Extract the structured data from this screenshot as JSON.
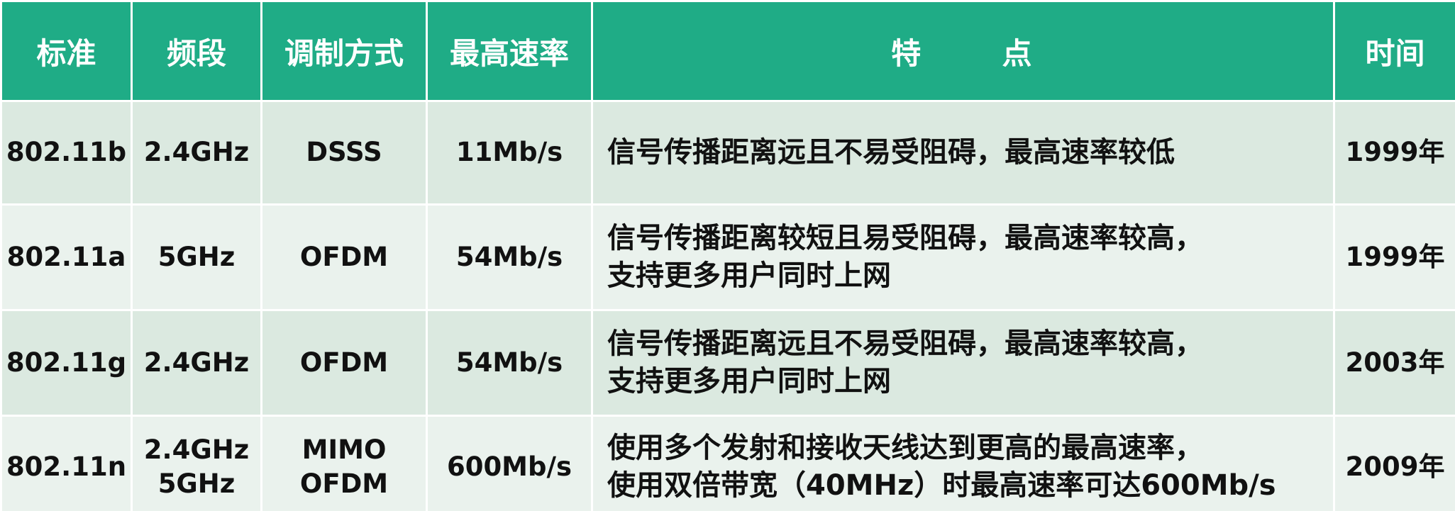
{
  "headers": {
    "standard": "标准",
    "band": "频段",
    "modulation": "调制方式",
    "max_rate": "最高速率",
    "feature_a": "特",
    "feature_b": "点",
    "time": "时间"
  },
  "rows": [
    {
      "standard": "802.11b",
      "band": [
        "2.4GHz"
      ],
      "modulation": [
        "DSSS"
      ],
      "max_rate": "11Mb/s",
      "feature": [
        "信号传播距离远且不易受阻碍，最高速率较低"
      ],
      "time": "1999年"
    },
    {
      "standard": "802.11a",
      "band": [
        "5GHz"
      ],
      "modulation": [
        "OFDM"
      ],
      "max_rate": "54Mb/s",
      "feature": [
        "信号传播距离较短且易受阻碍，最高速率较高，",
        "支持更多用户同时上网"
      ],
      "time": "1999年"
    },
    {
      "standard": "802.11g",
      "band": [
        "2.4GHz"
      ],
      "modulation": [
        "OFDM"
      ],
      "max_rate": "54Mb/s",
      "feature": [
        "信号传播距离远且不易受阻碍，最高速率较高，",
        "支持更多用户同时上网"
      ],
      "time": "2003年"
    },
    {
      "standard": "802.11n",
      "band": [
        "2.4GHz",
        "5GHz"
      ],
      "modulation": [
        "MIMO",
        "OFDM"
      ],
      "max_rate": "600Mb/s",
      "feature": [
        "使用多个发射和接收天线达到更高的最高速率，",
        "使用双倍带宽（40MHz）时最高速率可达600Mb/s"
      ],
      "time": "2009年"
    }
  ]
}
